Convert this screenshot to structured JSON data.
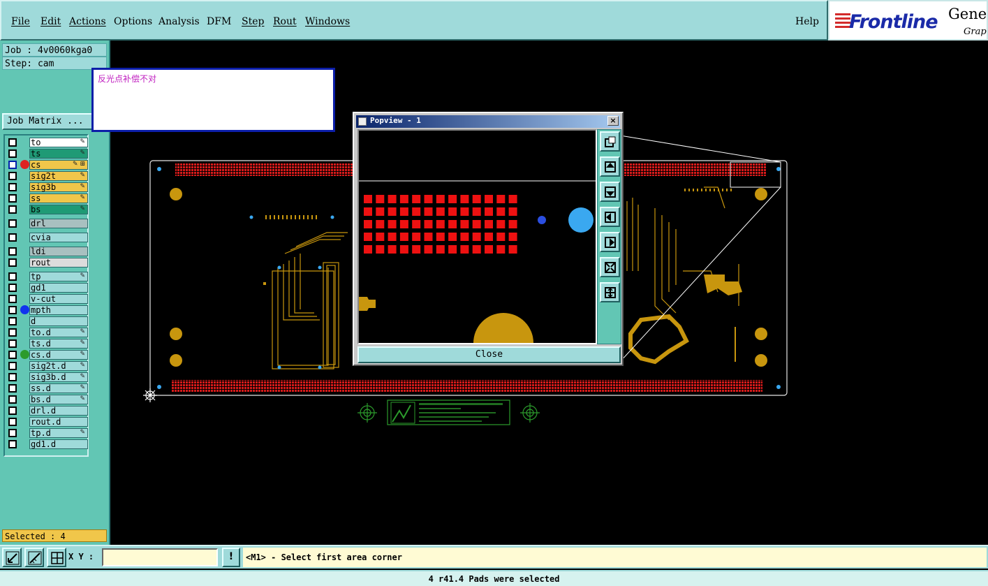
{
  "menu": {
    "items": [
      "File",
      "Edit",
      "Actions",
      "Options",
      "Analysis",
      "DFM",
      "Step",
      "Rout",
      "Windows"
    ],
    "help": "Help"
  },
  "logo": {
    "brand": "Frontline",
    "product": "Genes",
    "sub": "Graph"
  },
  "job": {
    "job_label": "Job : 4v0060kga0",
    "step_label": "Step: cam",
    "matrix_button": "Job Matrix ..."
  },
  "layers": [
    {
      "name": "to",
      "color": "#ffffff",
      "flag": "✎"
    },
    {
      "name": "ts",
      "color": "#1f9a75",
      "flag": "✎"
    },
    {
      "name": "cs",
      "color": "#f0c64a",
      "flag": "✎ ⊞",
      "active": true,
      "dot": "#d22"
    },
    {
      "name": "sig2t",
      "color": "#f0c64a",
      "flag": "✎"
    },
    {
      "name": "sig3b",
      "color": "#f0c64a",
      "flag": "✎"
    },
    {
      "name": "ss",
      "color": "#f0c64a",
      "flag": "✎"
    },
    {
      "name": "bs",
      "color": "#1f9a75",
      "flag": "✎"
    },
    {
      "name": "drl",
      "color": "#a8c0c0",
      "flag": ""
    },
    {
      "name": "cvia",
      "color": "#9fdada",
      "flag": ""
    },
    {
      "name": "ldi",
      "color": "#a8c0c0",
      "flag": ""
    },
    {
      "name": "rout",
      "color": "#dcdcdc",
      "flag": ""
    },
    {
      "name": "tp",
      "color": "#9fdada",
      "flag": "✎"
    },
    {
      "name": "gd1",
      "color": "#9fdada",
      "flag": ""
    },
    {
      "name": "v-cut",
      "color": "#9fdada",
      "flag": ""
    },
    {
      "name": "mpth",
      "color": "#9fdada",
      "flag": "",
      "dot": "#1133ee"
    },
    {
      "name": "d",
      "color": "#9fdada",
      "flag": ""
    },
    {
      "name": "to.d",
      "color": "#9fdada",
      "flag": "✎"
    },
    {
      "name": "ts.d",
      "color": "#9fdada",
      "flag": "✎"
    },
    {
      "name": "cs.d",
      "color": "#9fdada",
      "flag": "✎",
      "dot": "#2c9b2c"
    },
    {
      "name": "sig2t.d",
      "color": "#9fdada",
      "flag": "✎"
    },
    {
      "name": "sig3b.d",
      "color": "#9fdada",
      "flag": "✎"
    },
    {
      "name": "ss.d",
      "color": "#9fdada",
      "flag": "✎"
    },
    {
      "name": "bs.d",
      "color": "#9fdada",
      "flag": "✎"
    },
    {
      "name": "drl.d",
      "color": "#9fdada",
      "flag": ""
    },
    {
      "name": "rout.d",
      "color": "#9fdada",
      "flag": ""
    },
    {
      "name": "tp.d",
      "color": "#9fdada",
      "flag": "✎"
    },
    {
      "name": "gd1.d",
      "color": "#9fdada",
      "flag": ""
    }
  ],
  "selected_label": "Selected : 4",
  "note": "反光点补偿不对",
  "popview": {
    "title": "Popview - 1",
    "close_button": "Close",
    "tools": [
      "zoom-home-icon",
      "pan-up-icon",
      "pan-down-icon",
      "pan-left-icon",
      "pan-right-icon",
      "zoom-fit-icon",
      "zoom-center-icon"
    ]
  },
  "bottom": {
    "xy_label": "X Y :",
    "xy_value": "",
    "alert": "!",
    "prompt": "<M1> - Select first area corner"
  },
  "status": "4 r41.4 Pads were selected",
  "colors": {
    "copper": "#c8960e",
    "pad_red": "#ee1111",
    "via_blue": "#3aa8f0",
    "panel": "#9fdada",
    "panel_dark": "#62c6b4"
  }
}
